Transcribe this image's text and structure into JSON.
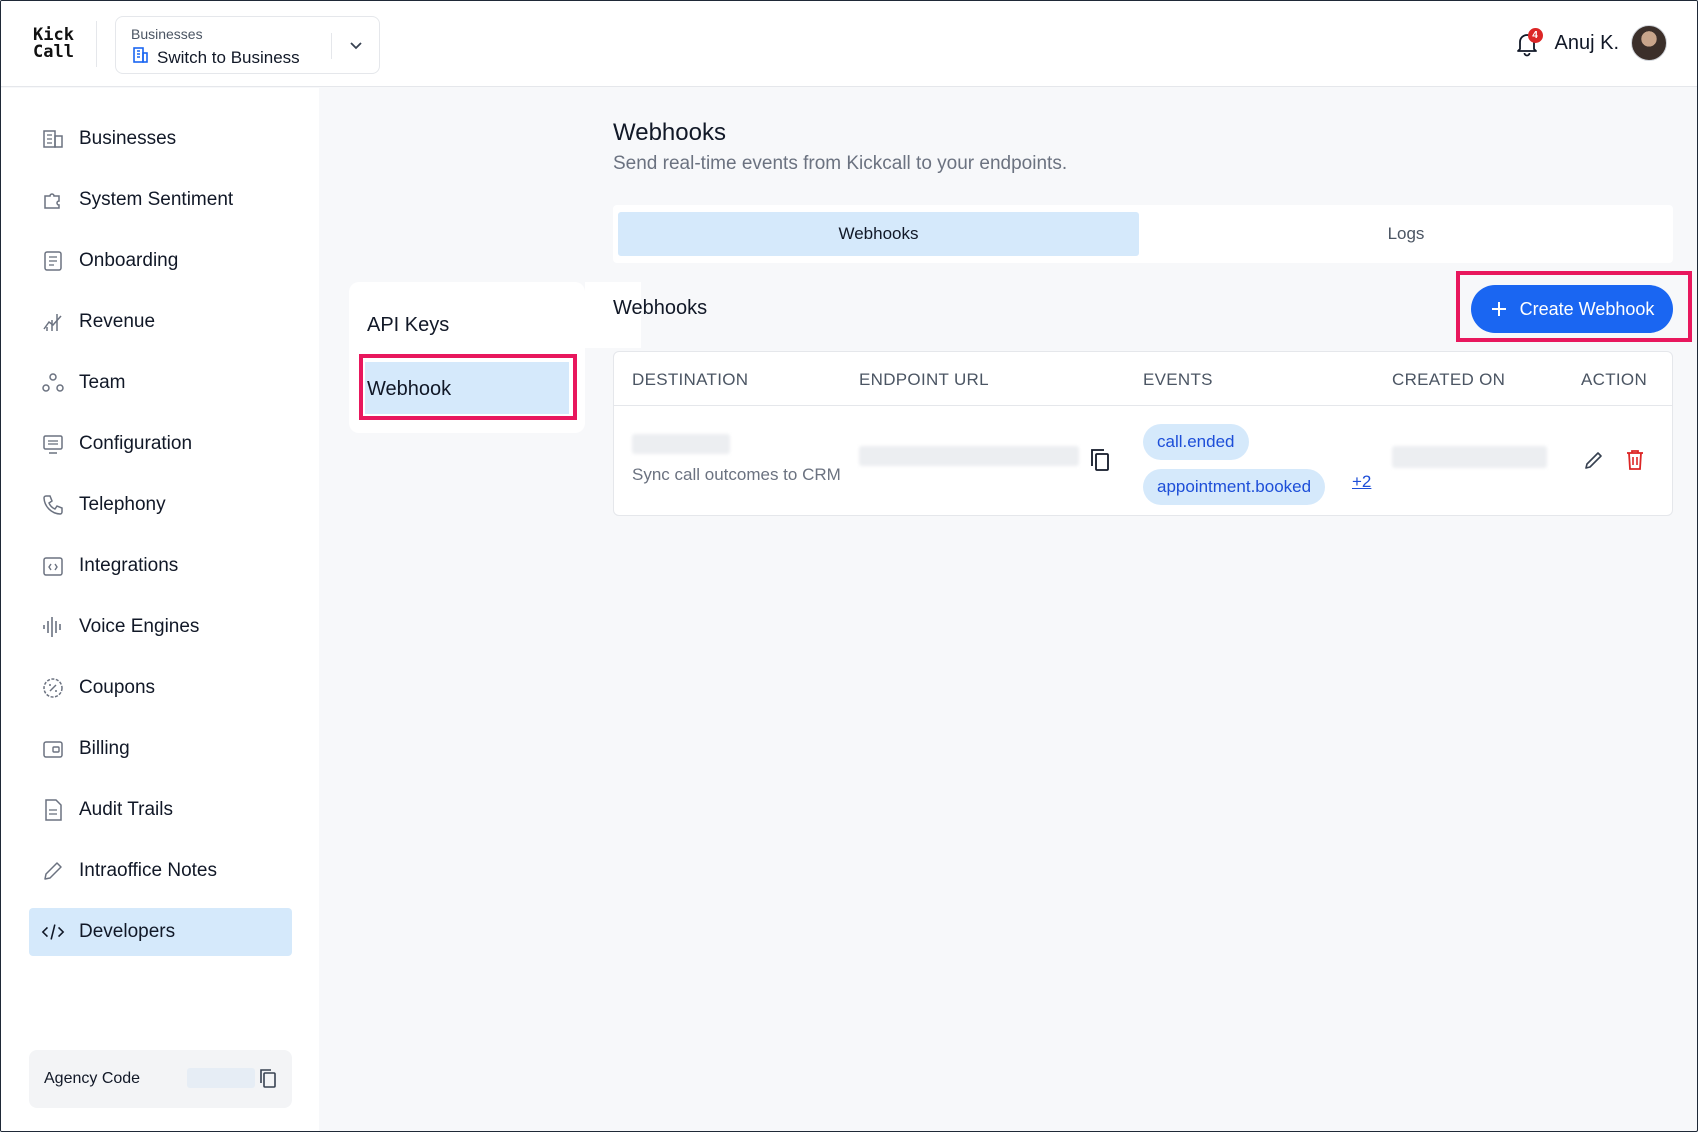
{
  "app": {
    "logo_line1": "Kick",
    "logo_line2": "Call"
  },
  "header": {
    "business_caption": "Businesses",
    "business_label": "Switch to Business",
    "notification_count": "4",
    "user_name": "Anuj K."
  },
  "sidebar": {
    "items": [
      {
        "label": "Businesses",
        "icon": "building-icon"
      },
      {
        "label": "System Sentiment",
        "icon": "puzzle-icon"
      },
      {
        "label": "Onboarding",
        "icon": "document-icon"
      },
      {
        "label": "Revenue",
        "icon": "chart-icon"
      },
      {
        "label": "Team",
        "icon": "team-icon"
      },
      {
        "label": "Configuration",
        "icon": "monitor-icon"
      },
      {
        "label": "Telephony",
        "icon": "phone-icon"
      },
      {
        "label": "Integrations",
        "icon": "code-box-icon"
      },
      {
        "label": "Voice Engines",
        "icon": "waveform-icon"
      },
      {
        "label": "Coupons",
        "icon": "discount-icon"
      },
      {
        "label": "Billing",
        "icon": "wallet-icon"
      },
      {
        "label": "Audit Trails",
        "icon": "file-icon"
      },
      {
        "label": "Intraoffice Notes",
        "icon": "pencil-icon"
      },
      {
        "label": "Developers",
        "icon": "code-icon"
      }
    ],
    "active_index": 13,
    "agency_label": "Agency Code"
  },
  "submenu": {
    "items": [
      "API Keys",
      "Webhook"
    ],
    "active": "Webhook"
  },
  "main": {
    "title": "Webhooks",
    "subtitle": "Send real-time events from Kickcall to your endpoints.",
    "tabs": [
      "Webhooks",
      "Logs"
    ],
    "active_tab": "Webhooks",
    "section_title": "Webhooks",
    "create_label": "Create Webhook"
  },
  "table": {
    "headers": [
      "DESTINATION",
      "ENDPOINT URL",
      "EVENTS",
      "CREATED ON",
      "ACTION"
    ],
    "rows": [
      {
        "description": "Sync call outcomes to CRM",
        "events": [
          "call.ended",
          "appointment.booked"
        ],
        "more_events": "+2"
      }
    ]
  },
  "colors": {
    "accent": "#1a66f2",
    "active_bg": "#d5e9fb",
    "highlight": "#e8175d",
    "danger": "#dc2626"
  }
}
